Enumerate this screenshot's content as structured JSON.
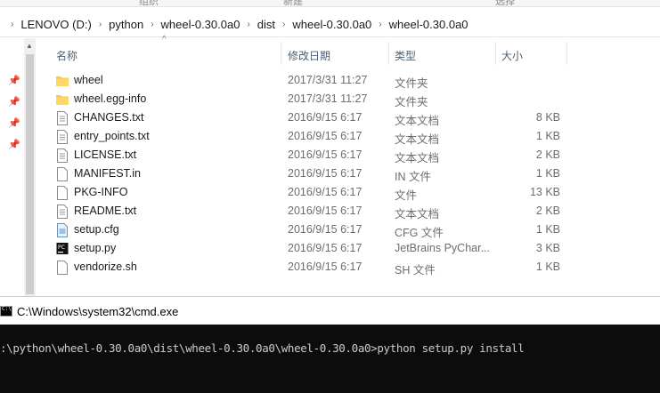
{
  "ribbon": {
    "labels": [
      "组织",
      "新建",
      "选择"
    ]
  },
  "breadcrumbs": [
    "LENOVO (D:)",
    "python",
    "wheel-0.30.0a0",
    "dist",
    "wheel-0.30.0a0",
    "wheel-0.30.0a0"
  ],
  "columns": {
    "name": "名称",
    "date": "修改日期",
    "type": "类型",
    "size": "大小"
  },
  "files": [
    {
      "name": "wheel",
      "date": "2017/3/31 11:27",
      "type": "文件夹",
      "size": "",
      "icon": "folder-icon"
    },
    {
      "name": "wheel.egg-info",
      "date": "2017/3/31 11:27",
      "type": "文件夹",
      "size": "",
      "icon": "folder-icon"
    },
    {
      "name": "CHANGES.txt",
      "date": "2016/9/15 6:17",
      "type": "文本文档",
      "size": "8 KB",
      "icon": "text-file-icon"
    },
    {
      "name": "entry_points.txt",
      "date": "2016/9/15 6:17",
      "type": "文本文档",
      "size": "1 KB",
      "icon": "text-file-icon"
    },
    {
      "name": "LICENSE.txt",
      "date": "2016/9/15 6:17",
      "type": "文本文档",
      "size": "2 KB",
      "icon": "text-file-icon"
    },
    {
      "name": "MANIFEST.in",
      "date": "2016/9/15 6:17",
      "type": "IN 文件",
      "size": "1 KB",
      "icon": "blank-file-icon"
    },
    {
      "name": "PKG-INFO",
      "date": "2016/9/15 6:17",
      "type": "文件",
      "size": "13 KB",
      "icon": "blank-file-icon"
    },
    {
      "name": "README.txt",
      "date": "2016/9/15 6:17",
      "type": "文本文档",
      "size": "2 KB",
      "icon": "text-file-icon"
    },
    {
      "name": "setup.cfg",
      "date": "2016/9/15 6:17",
      "type": "CFG 文件",
      "size": "1 KB",
      "icon": "config-file-icon"
    },
    {
      "name": "setup.py",
      "date": "2016/9/15 6:17",
      "type": "JetBrains PyChar...",
      "size": "3 KB",
      "icon": "pycharm-file-icon"
    },
    {
      "name": "vendorize.sh",
      "date": "2016/9/15 6:17",
      "type": "SH 文件",
      "size": "1 KB",
      "icon": "blank-file-icon"
    }
  ],
  "cmd": {
    "title": "C:\\Windows\\system32\\cmd.exe",
    "line": ":\\python\\wheel-0.30.0a0\\dist\\wheel-0.30.0a0\\wheel-0.30.0a0>python setup.py install"
  },
  "colors": {
    "header_text": "#4c607a",
    "folder": "#f2c94c",
    "console_bg": "#0c0c0c",
    "console_text": "#cccccc"
  }
}
